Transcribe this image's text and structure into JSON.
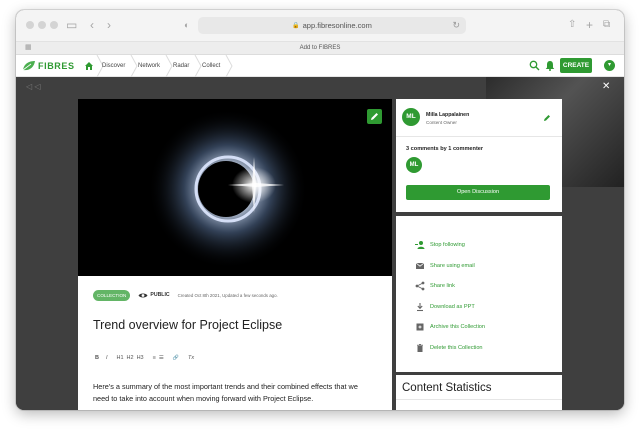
{
  "browser": {
    "url": "app.fibresonline.com",
    "favorites_bar": "Add to FIBRES"
  },
  "nav": {
    "logo_text": "FIBRES",
    "breadcrumbs": [
      "Discover",
      "Network",
      "Radar",
      "Collect"
    ],
    "create_label": "CREATE"
  },
  "collection": {
    "type_badge": "COLLECTION",
    "visibility": "PUBLIC",
    "created": "Created Oct 8th 2021, Updated a few seconds ago.",
    "title": "Trend overview for Project Eclipse",
    "toolbar": [
      "B",
      "I",
      "H1",
      "H2",
      "H3",
      "≡",
      "☰",
      "🔗",
      "Tx"
    ],
    "body_line1": "Here's a summary of the most important trends and their combined effects that we",
    "body_line2": "need to take into account when moving forward with Project Eclipse."
  },
  "owner": {
    "initials": "ML",
    "name": "Milla Lappalainen",
    "role": "Content Owner"
  },
  "comments": {
    "summary": "3 comments by 1 commenter",
    "commenter_initials": "ML",
    "open_label": "Open Discussion"
  },
  "actions": [
    {
      "label": "Stop following",
      "icon": "person-minus-icon"
    },
    {
      "label": "Share using email",
      "icon": "email-icon"
    },
    {
      "label": "Share link",
      "icon": "share-icon"
    },
    {
      "label": "Download as PPT",
      "icon": "download-icon"
    },
    {
      "label": "Archive this Collection",
      "icon": "archive-icon"
    },
    {
      "label": "Delete this Collection",
      "icon": "trash-icon"
    }
  ],
  "stats": {
    "title": "Content Statistics"
  },
  "colors": {
    "brand_green": "#2f9a32",
    "pill_green": "#63b566",
    "backdrop": "#3f3f3f"
  }
}
